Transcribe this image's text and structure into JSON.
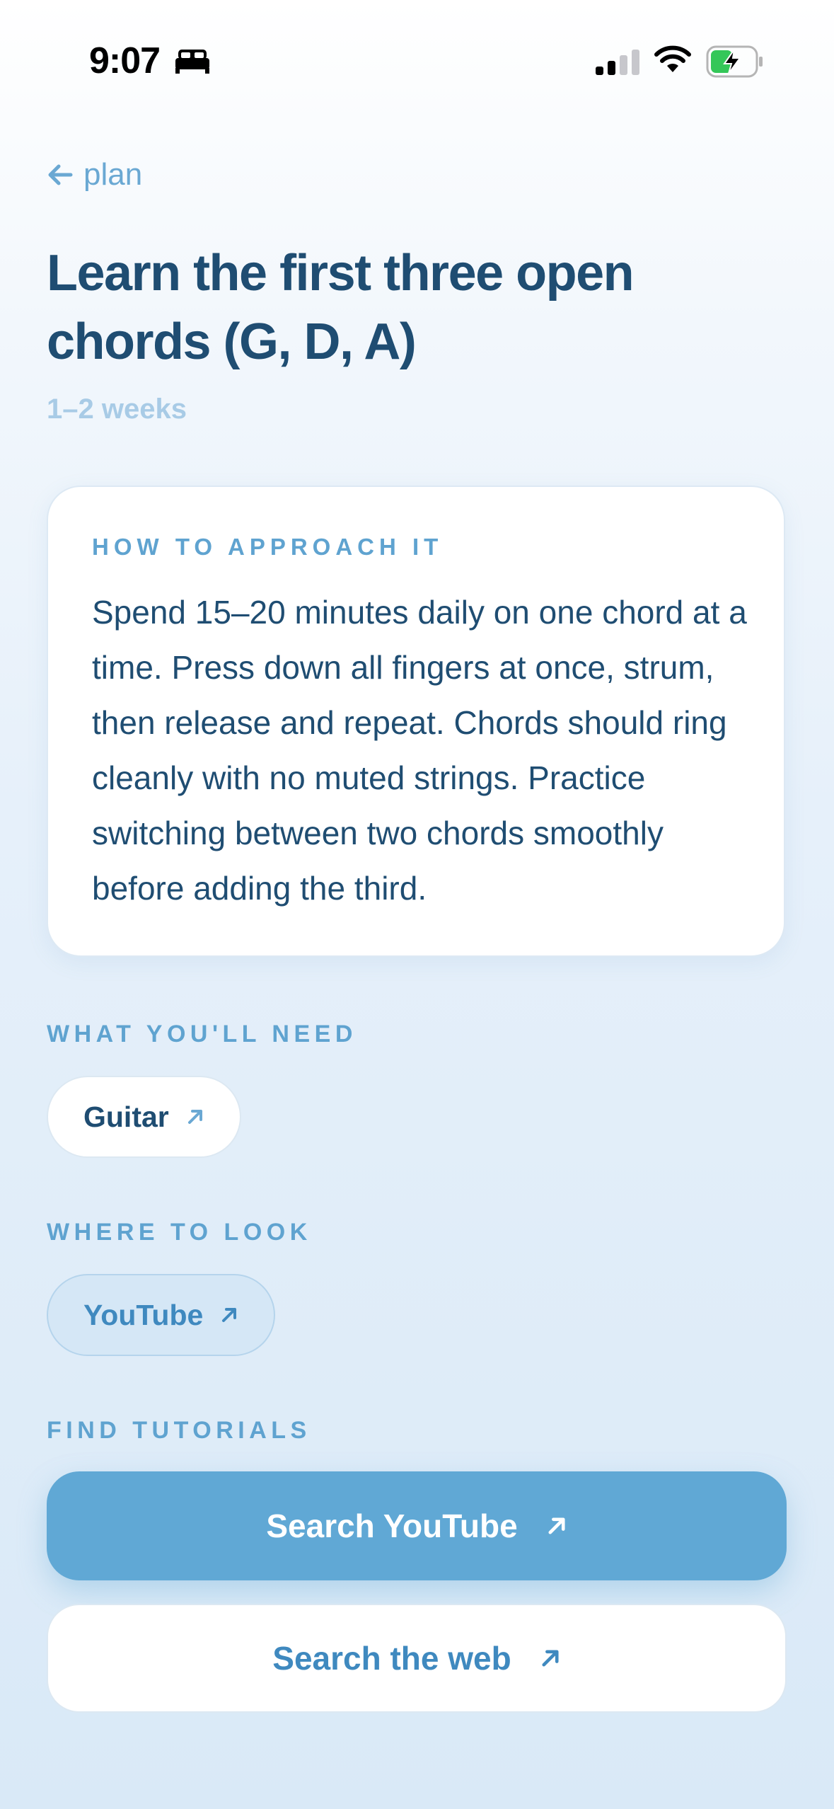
{
  "status_bar": {
    "time": "9:07"
  },
  "nav": {
    "back_label": "plan"
  },
  "step": {
    "title": "Learn the first three open chords (G, D, A)",
    "duration": "1–2 weeks"
  },
  "approach": {
    "heading": "HOW TO APPROACH IT",
    "body": "Spend 15–20 minutes daily on one chord at a time. Press down all fingers at once, strum, then release and repeat. Chords should ring cleanly with no muted strings. Practice switching between two chords smoothly before adding the third."
  },
  "needs": {
    "heading": "WHAT YOU'LL NEED",
    "items": [
      {
        "label": "Guitar",
        "icon": "arrow-up-right-icon"
      }
    ]
  },
  "where": {
    "heading": "WHERE TO LOOK",
    "items": [
      {
        "label": "YouTube",
        "icon": "arrow-up-right-icon"
      }
    ]
  },
  "tutorials": {
    "heading": "FIND TUTORIALS",
    "primary_label": "Search YouTube",
    "secondary_label": "Search the web"
  },
  "colors": {
    "accent": "#60a8d5",
    "title": "#1f4d72",
    "muted": "#a8cbe6",
    "label": "#5fa3d0"
  }
}
